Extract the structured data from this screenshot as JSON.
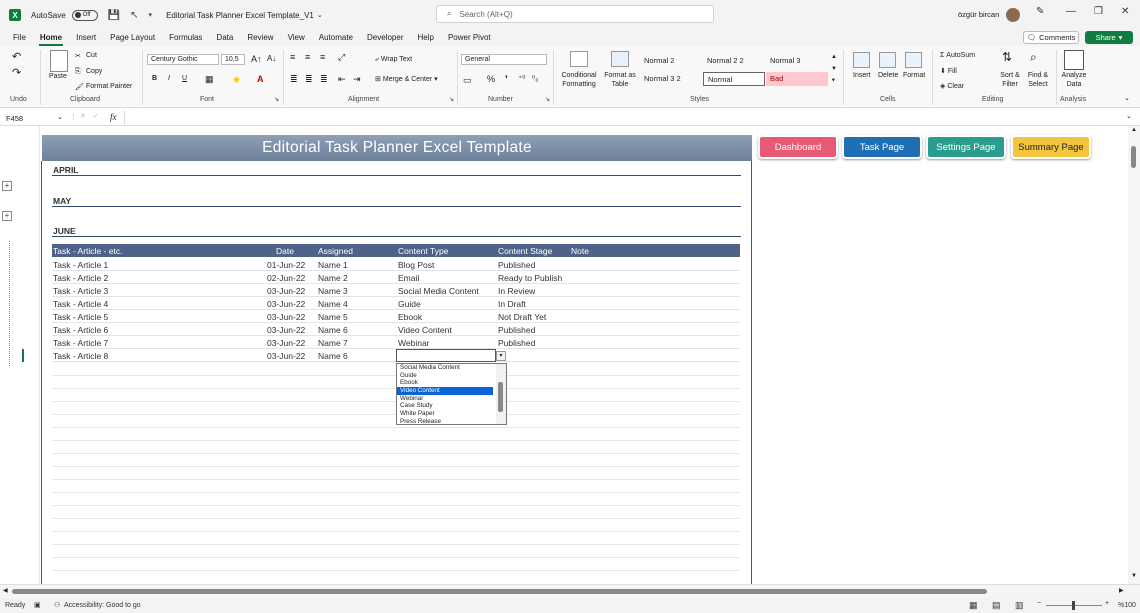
{
  "titlebar": {
    "autosave_label": "AutoSave",
    "autosave_state": "Off",
    "doc_title": "Editorial Task Planner Excel Template_V1",
    "search_placeholder": "Search (Alt+Q)",
    "user_name": "özgür bircan"
  },
  "menu": {
    "tabs": [
      "File",
      "Home",
      "Insert",
      "Page Layout",
      "Formulas",
      "Data",
      "Review",
      "View",
      "Automate",
      "Developer",
      "Help",
      "Power Pivot"
    ],
    "active": "Home",
    "comments": "Comments",
    "share": "Share"
  },
  "ribbon": {
    "undo_group": "Undo",
    "clipboard": {
      "paste": "Paste",
      "cut": "Cut",
      "copy": "Copy",
      "format_painter": "Format Painter",
      "label": "Clipboard"
    },
    "font": {
      "name": "Century Gothic",
      "size": "10,5",
      "label": "Font"
    },
    "alignment": {
      "wrap_text": "Wrap Text",
      "merge_center": "Merge & Center",
      "label": "Alignment"
    },
    "number": {
      "format": "General",
      "label": "Number"
    },
    "styles": {
      "conditional": "Conditional Formatting",
      "format_as_table": "Format as Table",
      "normal2": "Normal 2",
      "normal22": "Normal 2 2",
      "normal3": "Normal 3",
      "normal32": "Normal 3 2",
      "normal": "Normal",
      "bad": "Bad",
      "label": "Styles"
    },
    "cells": {
      "insert": "Insert",
      "delete": "Delete",
      "format": "Format",
      "label": "Cells"
    },
    "editing": {
      "autosum": "AutoSum",
      "fill": "Fill",
      "clear": "Clear",
      "sort_filter": "Sort & Filter",
      "find_select": "Find & Select",
      "label": "Editing"
    },
    "analysis": {
      "analyze": "Analyze Data",
      "label": "Analysis"
    }
  },
  "formula_bar": {
    "name_box": "F458",
    "fx": "fx",
    "value": ""
  },
  "sheet": {
    "banner_title": "Editorial Task Planner Excel Template",
    "nav_buttons": [
      "Dashboard",
      "Task Page",
      "Settings Page",
      "Summary Page"
    ],
    "months": [
      "APRIL",
      "MAY",
      "JUNE"
    ],
    "columns": [
      "Task - Article - etc.",
      "Date",
      "Assigned",
      "Content Type",
      "Content Stage",
      "Note"
    ],
    "rows": [
      [
        "Task - Article 1",
        "01-Jun-22",
        "Name 1",
        "Blog Post",
        "Published"
      ],
      [
        "Task - Article 2",
        "02-Jun-22",
        "Name 2",
        "Email",
        "Ready to Publish"
      ],
      [
        "Task - Article 3",
        "03-Jun-22",
        "Name 3",
        "Social Media Content",
        "In Review"
      ],
      [
        "Task - Article 4",
        "03-Jun-22",
        "Name 4",
        "Guide",
        "In Draft"
      ],
      [
        "Task - Article 5",
        "03-Jun-22",
        "Name 5",
        "Ebook",
        "Not Draft Yet"
      ],
      [
        "Task - Article 6",
        "03-Jun-22",
        "Name 6",
        "Video Content",
        "Published"
      ],
      [
        "Task - Article 7",
        "03-Jun-22",
        "Name 7",
        "Webinar",
        "Published"
      ],
      [
        "Task - Article 8",
        "03-Jun-22",
        "Name 6",
        "",
        ""
      ]
    ],
    "dropdown_options": [
      "Social Media Content",
      "Guide",
      "Ebook",
      "Video Content",
      "Webinar",
      "Case Study",
      "White Paper",
      "Press Release"
    ],
    "dropdown_selected": "Video Content"
  },
  "status": {
    "ready": "Ready",
    "accessibility": "Accessibility: Good to go",
    "zoom": "%100"
  },
  "colors": {
    "accent": "#107c41",
    "header": "#4e628a",
    "dashboard": "#e85a73",
    "task": "#1f6fb5",
    "settings": "#2a9d8f",
    "summary": "#f2c53d"
  }
}
